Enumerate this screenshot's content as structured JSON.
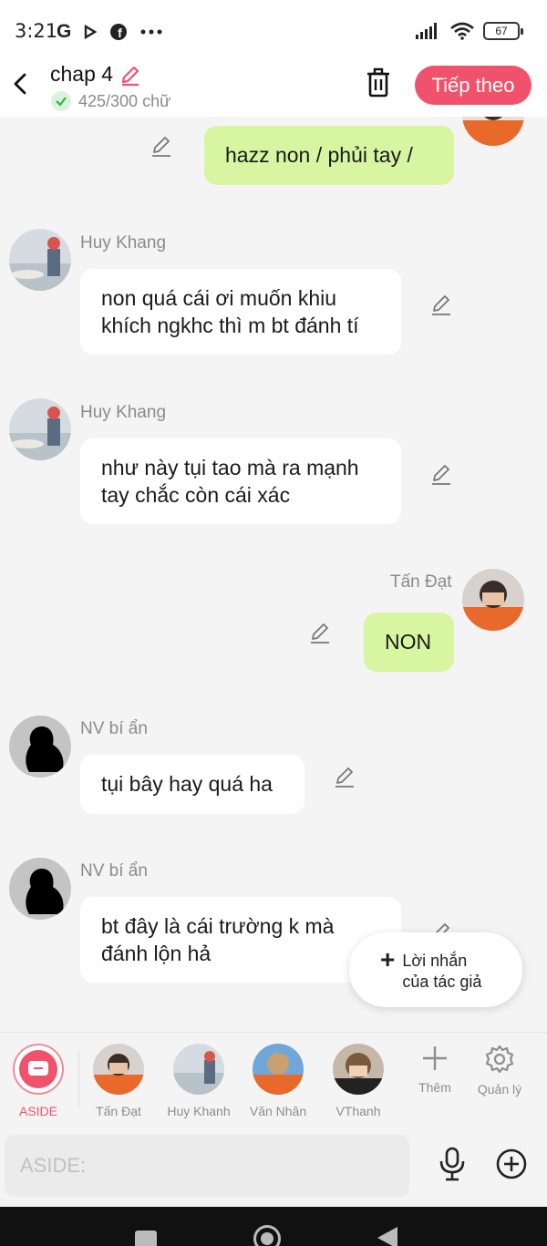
{
  "status_bar": {
    "time": "3:21",
    "carrier_icon": "G",
    "battery": "67"
  },
  "header": {
    "title": "chap 4",
    "word_count": "425/300 chữ",
    "next_label": "Tiếp theo"
  },
  "messages": [
    {
      "side": "right",
      "sender": "",
      "text": "hazz non / phủi tay /"
    },
    {
      "side": "left",
      "sender": "Huy Khang",
      "text_line1": "non quá cái ơi muốn khiu",
      "text_line2": "khích ngkhc thì m bt đánh tí"
    },
    {
      "side": "left",
      "sender": "Huy Khang",
      "text_line1": "như này tụi tao mà ra mạnh",
      "text_line2": "tay chắc còn cái xác"
    },
    {
      "side": "right",
      "sender": "Tấn Đạt",
      "text": "NON"
    },
    {
      "side": "left",
      "sender": "NV bí ẩn",
      "text": "tụi bây hay quá ha"
    },
    {
      "side": "left",
      "sender": "NV bí ẩn",
      "text_line1": "bt đây là cái trường k mà",
      "text_line2": "đánh lộn hả"
    }
  ],
  "author_note": {
    "line1": "Lời nhắn",
    "line2": "của tác giả"
  },
  "characters": [
    {
      "name": "ASIDE",
      "accent": "#f0526c"
    },
    {
      "name": "Tấn Đạt"
    },
    {
      "name": "Huy Khanh"
    },
    {
      "name": "Văn Nhân"
    },
    {
      "name": "VThanh"
    }
  ],
  "tools": {
    "add_label": "Thêm",
    "manage_label": "Quản lý"
  },
  "input": {
    "placeholder": "ASIDE:"
  },
  "colors": {
    "accent": "#f0526c",
    "bubble_green": "#d8f5a2",
    "bubble_white": "#ffffff"
  }
}
